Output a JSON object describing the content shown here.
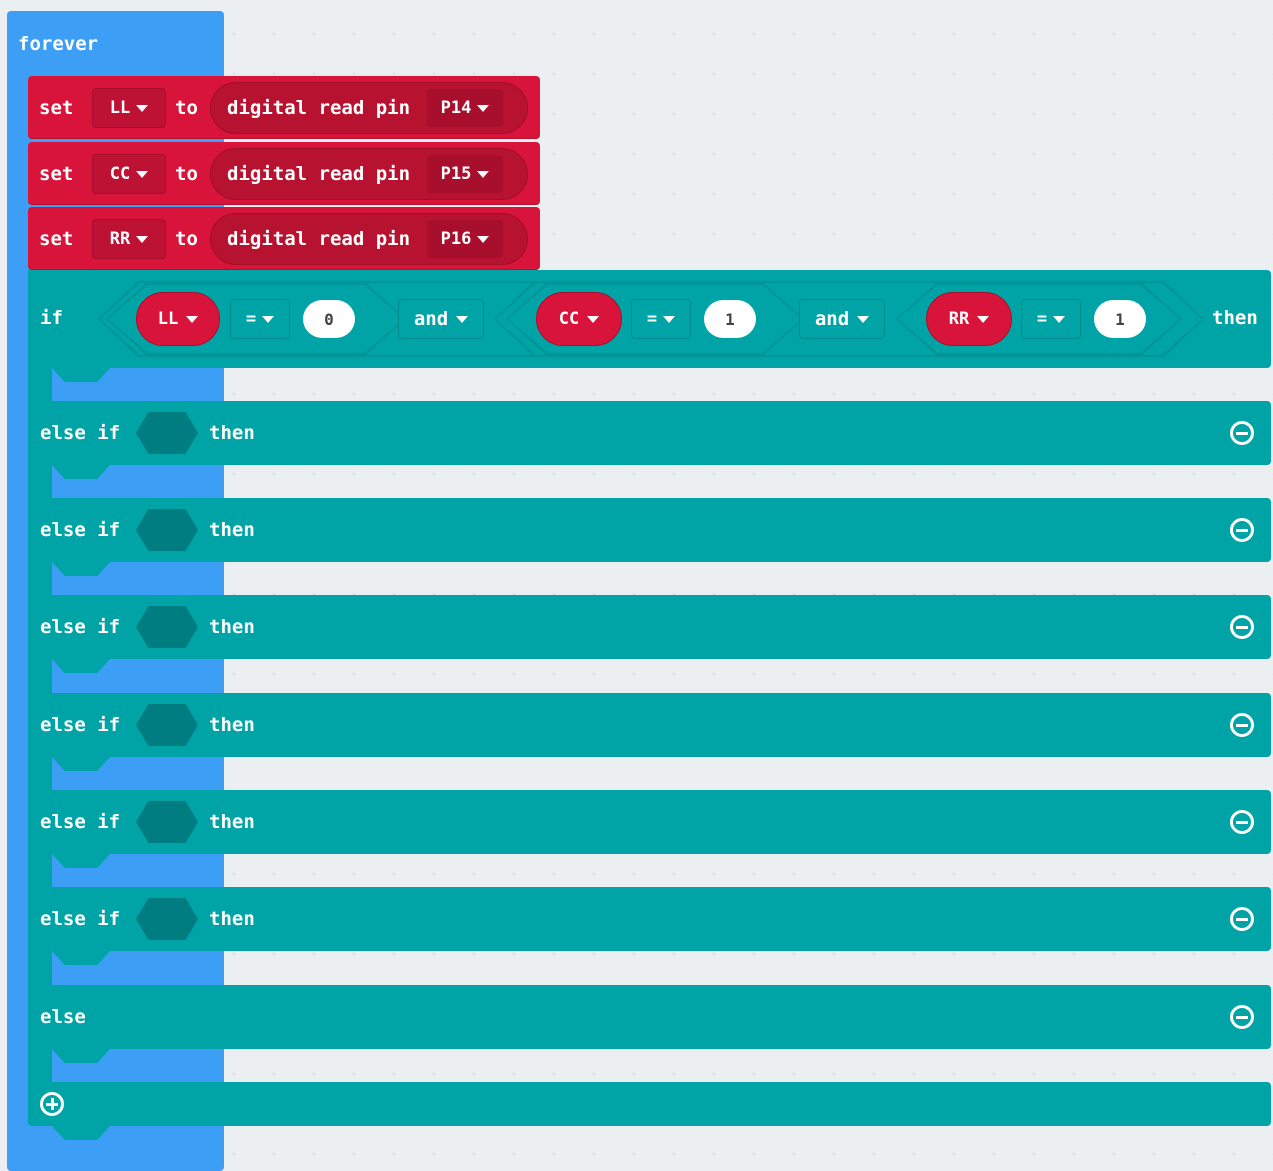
{
  "forever": {
    "label": "forever"
  },
  "set_blocks": [
    {
      "set_label": "set",
      "variable": "LL",
      "to_label": "to",
      "read_label": "digital read pin",
      "pin": "P14"
    },
    {
      "set_label": "set",
      "variable": "CC",
      "to_label": "to",
      "read_label": "digital read pin",
      "pin": "P15"
    },
    {
      "set_label": "set",
      "variable": "RR",
      "to_label": "to",
      "read_label": "digital read pin",
      "pin": "P16"
    }
  ],
  "if_block": {
    "if_label": "if",
    "then_label": "then",
    "conditions": [
      {
        "variable": "LL",
        "operator": "=",
        "value": "0"
      },
      {
        "variable": "CC",
        "operator": "=",
        "value": "1"
      },
      {
        "variable": "RR",
        "operator": "=",
        "value": "1"
      }
    ],
    "joiners": [
      "and",
      "and"
    ],
    "else_if_clauses": [
      {
        "label": "else if",
        "then_label": "then"
      },
      {
        "label": "else if",
        "then_label": "then"
      },
      {
        "label": "else if",
        "then_label": "then"
      },
      {
        "label": "else if",
        "then_label": "then"
      },
      {
        "label": "else if",
        "then_label": "then"
      },
      {
        "label": "else if",
        "then_label": "then"
      }
    ],
    "else_label": "else"
  },
  "colors": {
    "workspace": "#eceff2",
    "forever": "#3d9ef5",
    "variables": "#d8143a",
    "logic": "#00a4a6"
  },
  "icons": {
    "remove_clause": "minus-circle-icon",
    "add_clause": "plus-circle-icon",
    "dropdown": "caret-down-icon"
  }
}
